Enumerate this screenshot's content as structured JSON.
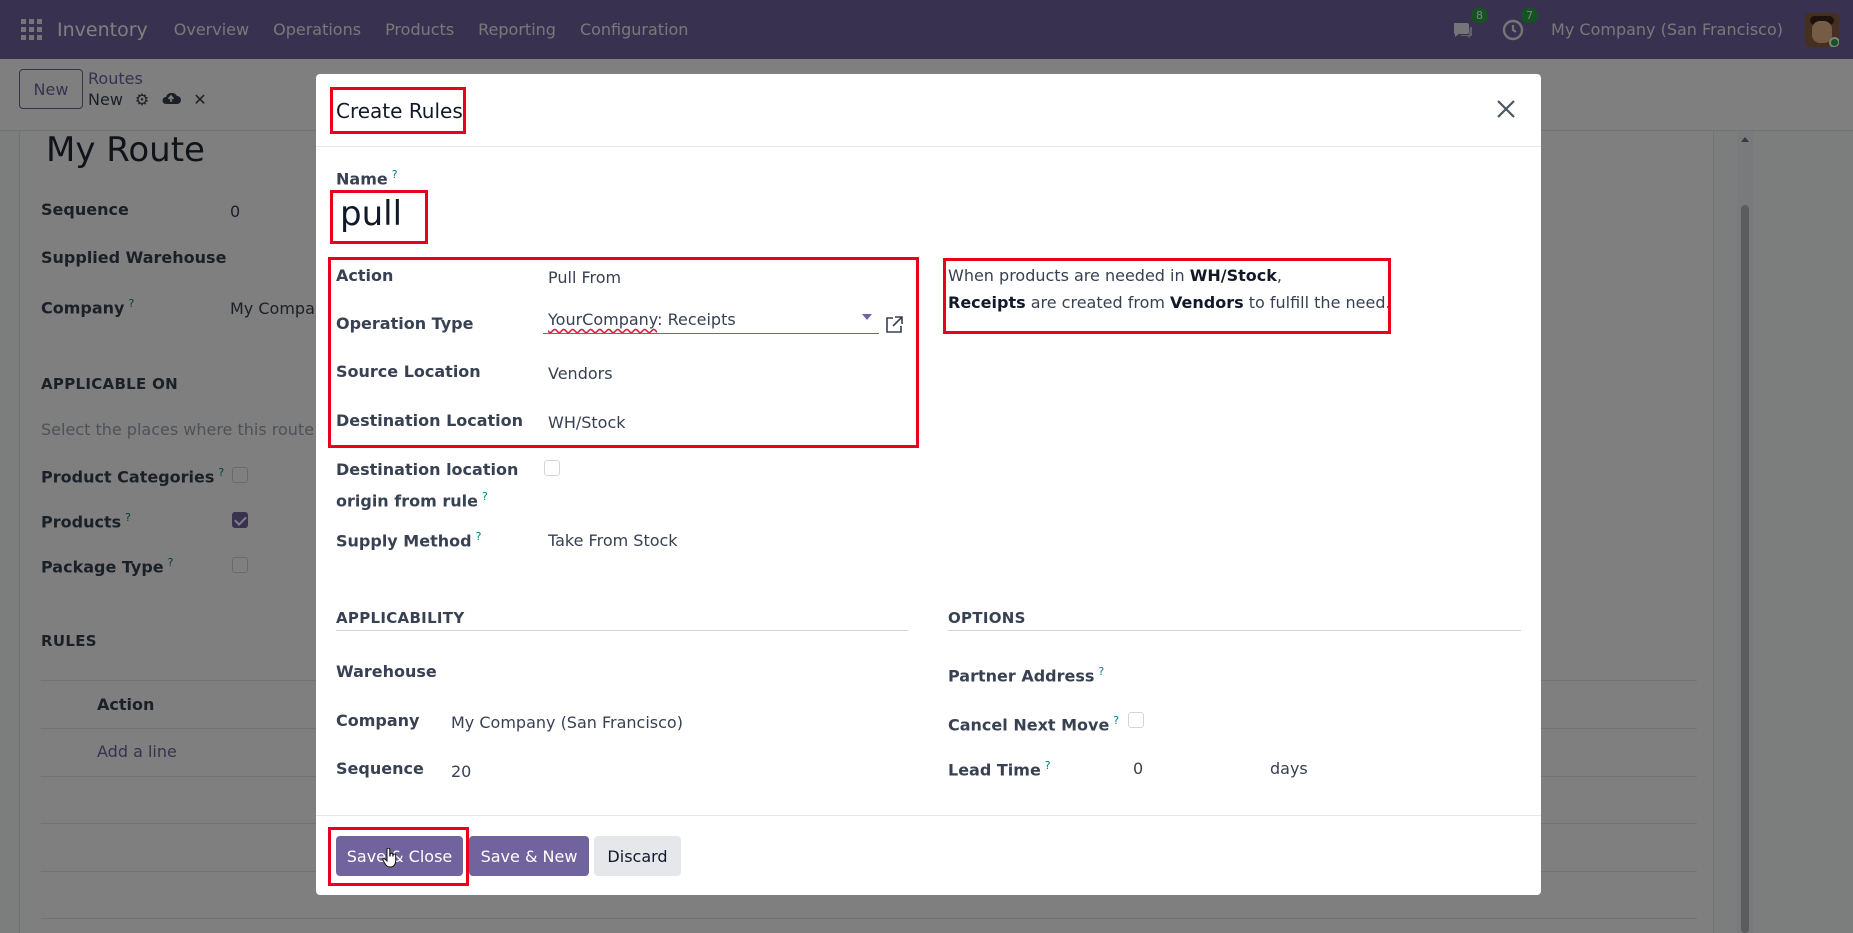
{
  "navbar": {
    "app_name": "Inventory",
    "menu": [
      "Overview",
      "Operations",
      "Products",
      "Reporting",
      "Configuration"
    ],
    "messages_count": "8",
    "activities_count": "7",
    "company": "My Company (San Francisco)"
  },
  "control_panel": {
    "new_label": "New",
    "breadcrumb_parent": "Routes",
    "breadcrumb_current": "New"
  },
  "background_form": {
    "title": "My Route",
    "sequence_label": "Sequence",
    "sequence_value": "0",
    "supplied_warehouse_label": "Supplied Warehouse",
    "company_label": "Company",
    "company_value": "My Compan",
    "applicable_on_title": "APPLICABLE ON",
    "applicable_hint": "Select the places where this route c",
    "product_categories_label": "Product Categories",
    "product_categories_checked": false,
    "products_label": "Products",
    "products_checked": true,
    "package_type_label": "Package Type",
    "package_type_checked": false,
    "rules_title": "RULES",
    "rules_column_action": "Action",
    "add_line": "Add a line"
  },
  "modal": {
    "title": "Create Rules",
    "name_label": "Name",
    "name_value": "pull",
    "action_label": "Action",
    "action_value": "Pull From",
    "operation_type_label": "Operation Type",
    "operation_type_value": "YourCompany: Receipts",
    "source_location_label": "Source Location",
    "source_location_value": "Vendors",
    "destination_location_label": "Destination Location",
    "destination_location_value": "WH/Stock",
    "dest_origin_label_line1": "Destination location",
    "dest_origin_label_line2": "origin from rule",
    "supply_method_label": "Supply Method",
    "supply_method_value": "Take From Stock",
    "info": {
      "t1": "When products are needed in ",
      "b1": "WH/Stock",
      "t2": ",",
      "b2": "Receipts",
      "t3": " are created from ",
      "b3": "Vendors",
      "t4": " to fulfill the need."
    },
    "applicability_title": "APPLICABILITY",
    "warehouse_label": "Warehouse",
    "company_label": "Company",
    "company_value": "My Company (San Francisco)",
    "sequence_label": "Sequence",
    "sequence_value": "20",
    "options_title": "OPTIONS",
    "partner_address_label": "Partner Address",
    "cancel_next_move_label": "Cancel Next Move",
    "lead_time_label": "Lead Time",
    "lead_time_value": "0",
    "lead_time_unit": "days",
    "help_mark": "?",
    "buttons": {
      "save_close": "Save & Close",
      "save_new": "Save & New",
      "discard": "Discard"
    }
  },
  "colors": {
    "brand": "#71639e",
    "highlight": "#e8001c",
    "badge": "#28a745"
  }
}
